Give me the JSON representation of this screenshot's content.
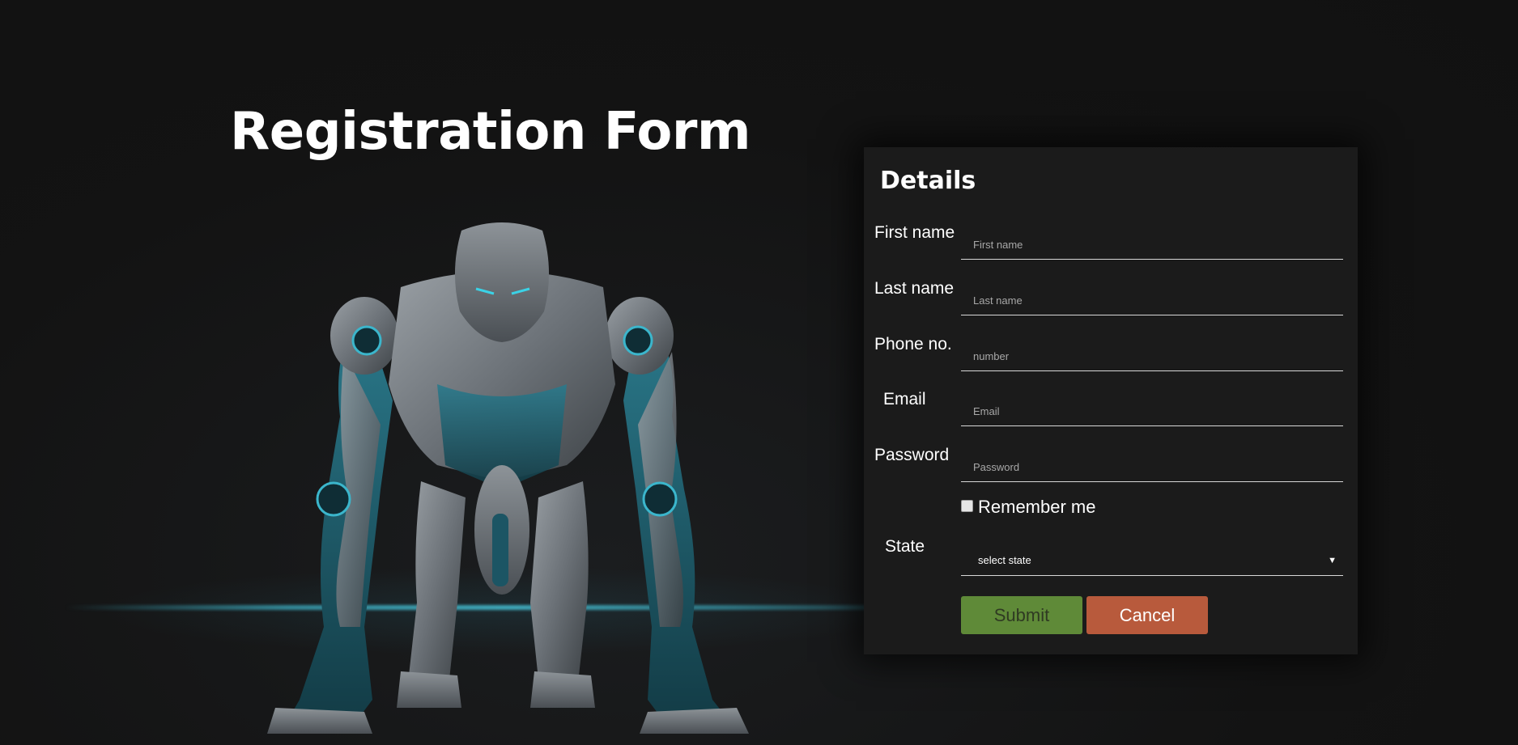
{
  "hero": {
    "title": "Registration Form"
  },
  "form": {
    "title": "Details",
    "fields": [
      {
        "label": "First name",
        "placeholder": "First name"
      },
      {
        "label": "Last name",
        "placeholder": "Last name"
      },
      {
        "label": "Phone no.",
        "placeholder": "number"
      },
      {
        "label": "Email",
        "placeholder": "Email"
      },
      {
        "label": "Password",
        "placeholder": "Password"
      }
    ],
    "remember_label": "Remember me",
    "remember_checked": false,
    "state": {
      "label": "State",
      "selected": "select state"
    },
    "submit_label": "Submit",
    "cancel_label": "Cancel"
  },
  "colors": {
    "background": "#121212",
    "panel": "#1b1b1b",
    "submit": "#5f8a38",
    "cancel": "#b85a3c",
    "accent_glow": "#46bed2"
  },
  "icons": {
    "select_arrow": "caret-down-icon",
    "hero_image": "robot-runner-illustration"
  }
}
